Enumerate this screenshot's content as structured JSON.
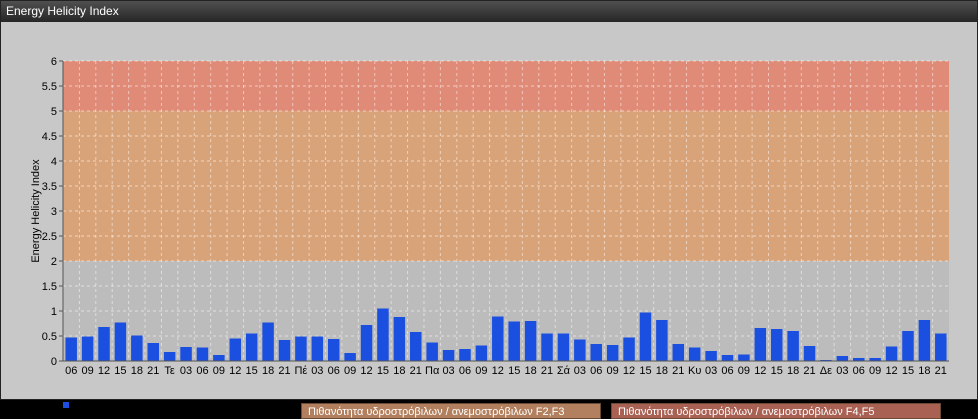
{
  "window": {
    "title": "Energy Helicity Index"
  },
  "colors": {
    "bar": "#1a4fe0",
    "zone_low": "#bcbcbc",
    "zone_f23": "#d9a37a",
    "zone_f45": "#e08a78",
    "plot_border": "#888888"
  },
  "chart_data": {
    "type": "bar",
    "title": "",
    "xlabel": "",
    "ylabel": "Energy Helicity Index",
    "ylim": [
      0,
      6
    ],
    "yticks": [
      "0",
      "0.5",
      "1",
      "1.5",
      "2",
      "2.5",
      "3",
      "3.5",
      "4",
      "4.5",
      "5",
      "5.5",
      "6"
    ],
    "grid": true,
    "legend_position": "bottom",
    "zones": [
      {
        "from": 2,
        "to": 5,
        "label": "Πιθανότητα υδροστρόβιλων / ανεμοστρόβιλων F2,F3"
      },
      {
        "from": 5,
        "to": 6,
        "label": "Πιθανότητα υδροστρόβιλων / ανεμοστρόβιλων F4,F5"
      }
    ],
    "categories": [
      "06",
      "09",
      "12",
      "15",
      "18",
      "21",
      "Τε",
      "03",
      "06",
      "09",
      "12",
      "15",
      "18",
      "21",
      "Πέ",
      "03",
      "06",
      "09",
      "12",
      "15",
      "18",
      "21",
      "Πα",
      "03",
      "06",
      "09",
      "12",
      "15",
      "18",
      "21",
      "Σά",
      "03",
      "06",
      "09",
      "12",
      "15",
      "18",
      "21",
      "Κυ",
      "03",
      "06",
      "09",
      "12",
      "15",
      "18",
      "21",
      "Δε",
      "03",
      "06",
      "09",
      "12",
      "15",
      "18",
      "21"
    ],
    "series": [
      {
        "name": "Energy Helicity Index",
        "values": [
          0.47,
          0.49,
          0.68,
          0.77,
          0.51,
          0.36,
          0.18,
          0.28,
          0.27,
          0.12,
          0.45,
          0.55,
          0.77,
          0.42,
          0.49,
          0.49,
          0.44,
          0.16,
          0.72,
          1.05,
          0.88,
          0.58,
          0.37,
          0.22,
          0.24,
          0.31,
          0.89,
          0.79,
          0.8,
          0.55,
          0.55,
          0.43,
          0.34,
          0.32,
          0.47,
          0.97,
          0.82,
          0.34,
          0.27,
          0.2,
          0.12,
          0.13,
          0.66,
          0.64,
          0.6,
          0.3,
          0.02,
          0.1,
          0.06,
          0.06,
          0.29,
          0.6,
          0.82,
          0.55
        ]
      }
    ]
  }
}
